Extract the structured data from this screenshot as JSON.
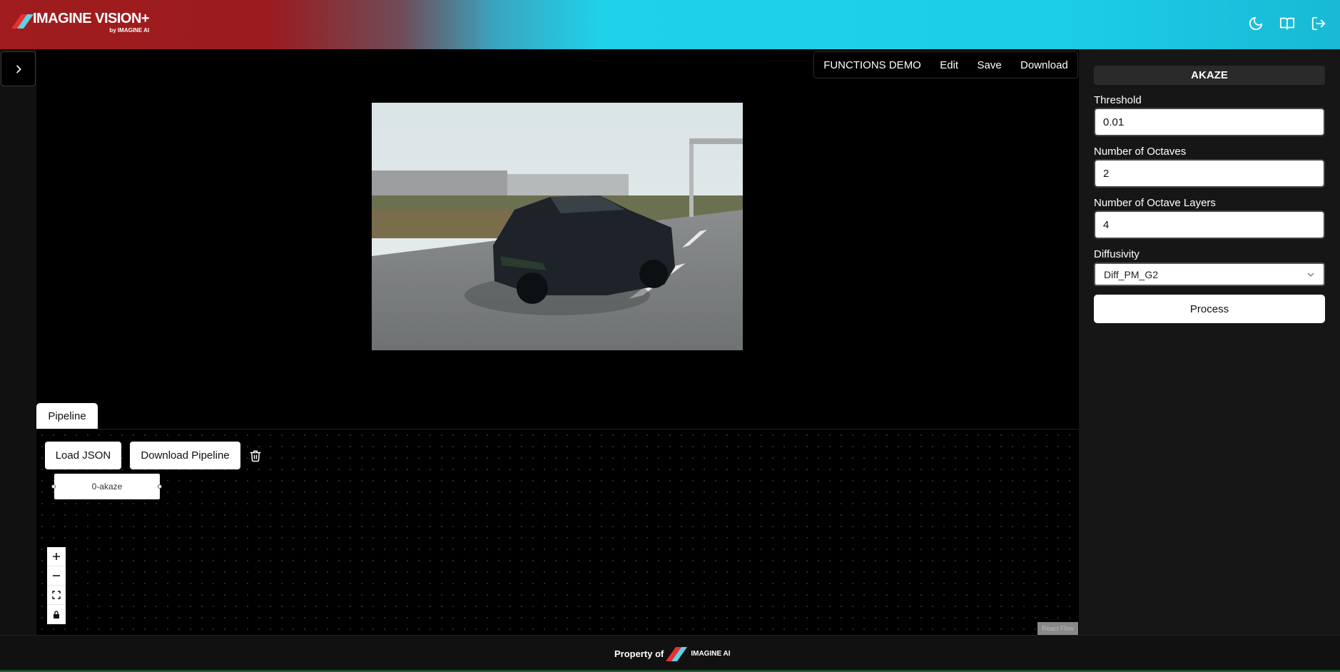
{
  "app": {
    "brand_name": "IMAGINE VISION+",
    "brand_sub": "by IMAGINE AI"
  },
  "header_icons": [
    "moon-icon",
    "book-icon",
    "logout-icon"
  ],
  "menu": {
    "functions_demo": "FUNCTIONS DEMO",
    "edit": "Edit",
    "save": "Save",
    "download": "Download"
  },
  "pipeline": {
    "tab_label": "Pipeline",
    "load_json": "Load JSON",
    "download_pipeline": "Download Pipeline",
    "node_label": "0-akaze",
    "attribution": "React Flow"
  },
  "panel": {
    "title": "AKAZE",
    "threshold_label": "Threshold",
    "threshold_value": "0.01",
    "octaves_label": "Number of Octaves",
    "octaves_value": "2",
    "octave_layers_label": "Number of Octave Layers",
    "octave_layers_value": "4",
    "diffusivity_label": "Diffusivity",
    "diffusivity_value": "Diff_PM_G2",
    "process_label": "Process"
  },
  "footer": {
    "property_text": "Property of",
    "brand": "IMAGINE AI"
  },
  "colors": {
    "header_red": "#a01c1e",
    "header_cyan": "#1fd2ea",
    "panel_bg": "#161616"
  }
}
